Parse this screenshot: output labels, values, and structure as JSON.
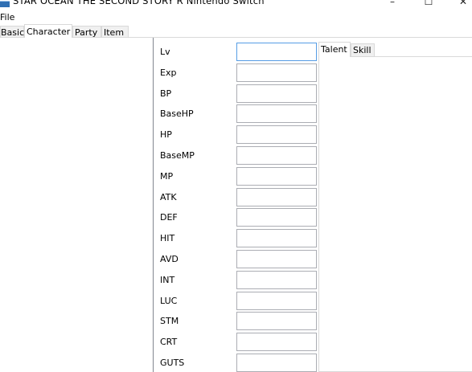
{
  "window": {
    "title": "STAR OCEAN THE SECOND STORY R Nintendo Switch",
    "minimize": "–",
    "maximize": "☐",
    "close": "✕"
  },
  "menu": {
    "file": "File"
  },
  "tabs": [
    {
      "label": "Basic",
      "active": false
    },
    {
      "label": "Character",
      "active": true
    },
    {
      "label": "Party",
      "active": false
    },
    {
      "label": "Item",
      "active": false
    }
  ],
  "stats": [
    {
      "label": "Lv",
      "value": ""
    },
    {
      "label": "Exp",
      "value": ""
    },
    {
      "label": "BP",
      "value": ""
    },
    {
      "label": "BaseHP",
      "value": ""
    },
    {
      "label": "HP",
      "value": ""
    },
    {
      "label": "BaseMP",
      "value": ""
    },
    {
      "label": "MP",
      "value": ""
    },
    {
      "label": "ATK",
      "value": ""
    },
    {
      "label": "DEF",
      "value": ""
    },
    {
      "label": "HIT",
      "value": ""
    },
    {
      "label": "AVD",
      "value": ""
    },
    {
      "label": "INT",
      "value": ""
    },
    {
      "label": "LUC",
      "value": ""
    },
    {
      "label": "STM",
      "value": ""
    },
    {
      "label": "CRT",
      "value": ""
    },
    {
      "label": "GUTS",
      "value": ""
    }
  ],
  "subtabs": [
    {
      "label": "Talent",
      "active": true
    },
    {
      "label": "Skill",
      "active": false
    }
  ],
  "colors": {
    "focus_border": "#569de5",
    "tab_border": "#d9d9d9",
    "input_border": "#abadb3"
  }
}
